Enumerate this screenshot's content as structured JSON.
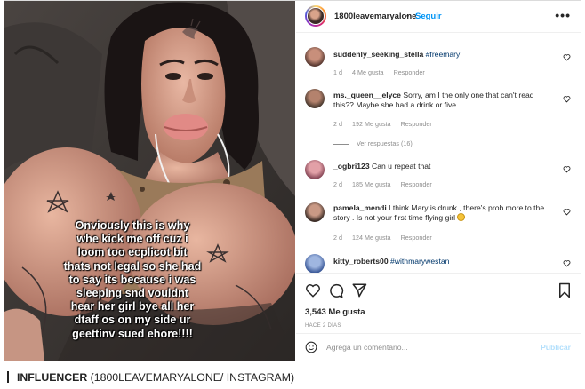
{
  "story": {
    "overlay_text": "Onviously this is why\nwhe kick me off cuz i\nloom too ecplicot bit\nthats not legal so she had\nto say its because i was\nsleeping snd vouldnt\nhear her girl bye all her\ndtaff os on my side ur\ngeettinv sued ehore!!!!"
  },
  "post_header": {
    "username": "1800leavemaryalone",
    "separator": "•",
    "follow_label": "Seguir",
    "more_label": "•••"
  },
  "comments": [
    {
      "username": "suddenly_seeking_stella",
      "text": "",
      "tag": "#freemary",
      "age": "1 d",
      "likes": "4 Me gusta",
      "reply": "Responder"
    },
    {
      "username": "ms._queen__elyce",
      "text": "Sorry, am I the only one that can't read this?? Maybe she had a drink or five...",
      "tag": "",
      "age": "2 d",
      "likes": "192 Me gusta",
      "reply": "Responder"
    },
    {
      "username": "_ogbri123",
      "text": "Can u repeat that",
      "tag": "",
      "age": "2 d",
      "likes": "185 Me gusta",
      "reply": "Responder"
    },
    {
      "username": "pamela_mendi",
      "text": "I think Mary is drunk , there's prob more to the story . Is not your first time flying girl",
      "tag": "",
      "age": "2 d",
      "likes": "124 Me gusta",
      "reply": "Responder"
    },
    {
      "username": "kitty_roberts00",
      "text": "",
      "tag": "#withmarywestan",
      "age": "",
      "likes": "",
      "reply": ""
    }
  ],
  "view_replies": "Ver respuestas (16)",
  "likes_count": "3,543 Me gusta",
  "posted_time": "HACE 2 DÍAS",
  "comment_box": {
    "placeholder": "Agrega un comentario...",
    "publish_label": "Publicar"
  },
  "caption": {
    "label": "INFLUENCER",
    "credit": "(1800LEAVEMARYALONE/ INSTAGRAM)"
  },
  "colors": {
    "link_blue": "#0095f6",
    "tag_blue": "#00376b",
    "muted_gray": "#8e8e8e",
    "publish_disabled": "#b2dffc"
  },
  "icons": [
    "heart-icon",
    "comment-icon",
    "share-icon",
    "bookmark-icon",
    "emoji-icon",
    "more-icon"
  ]
}
